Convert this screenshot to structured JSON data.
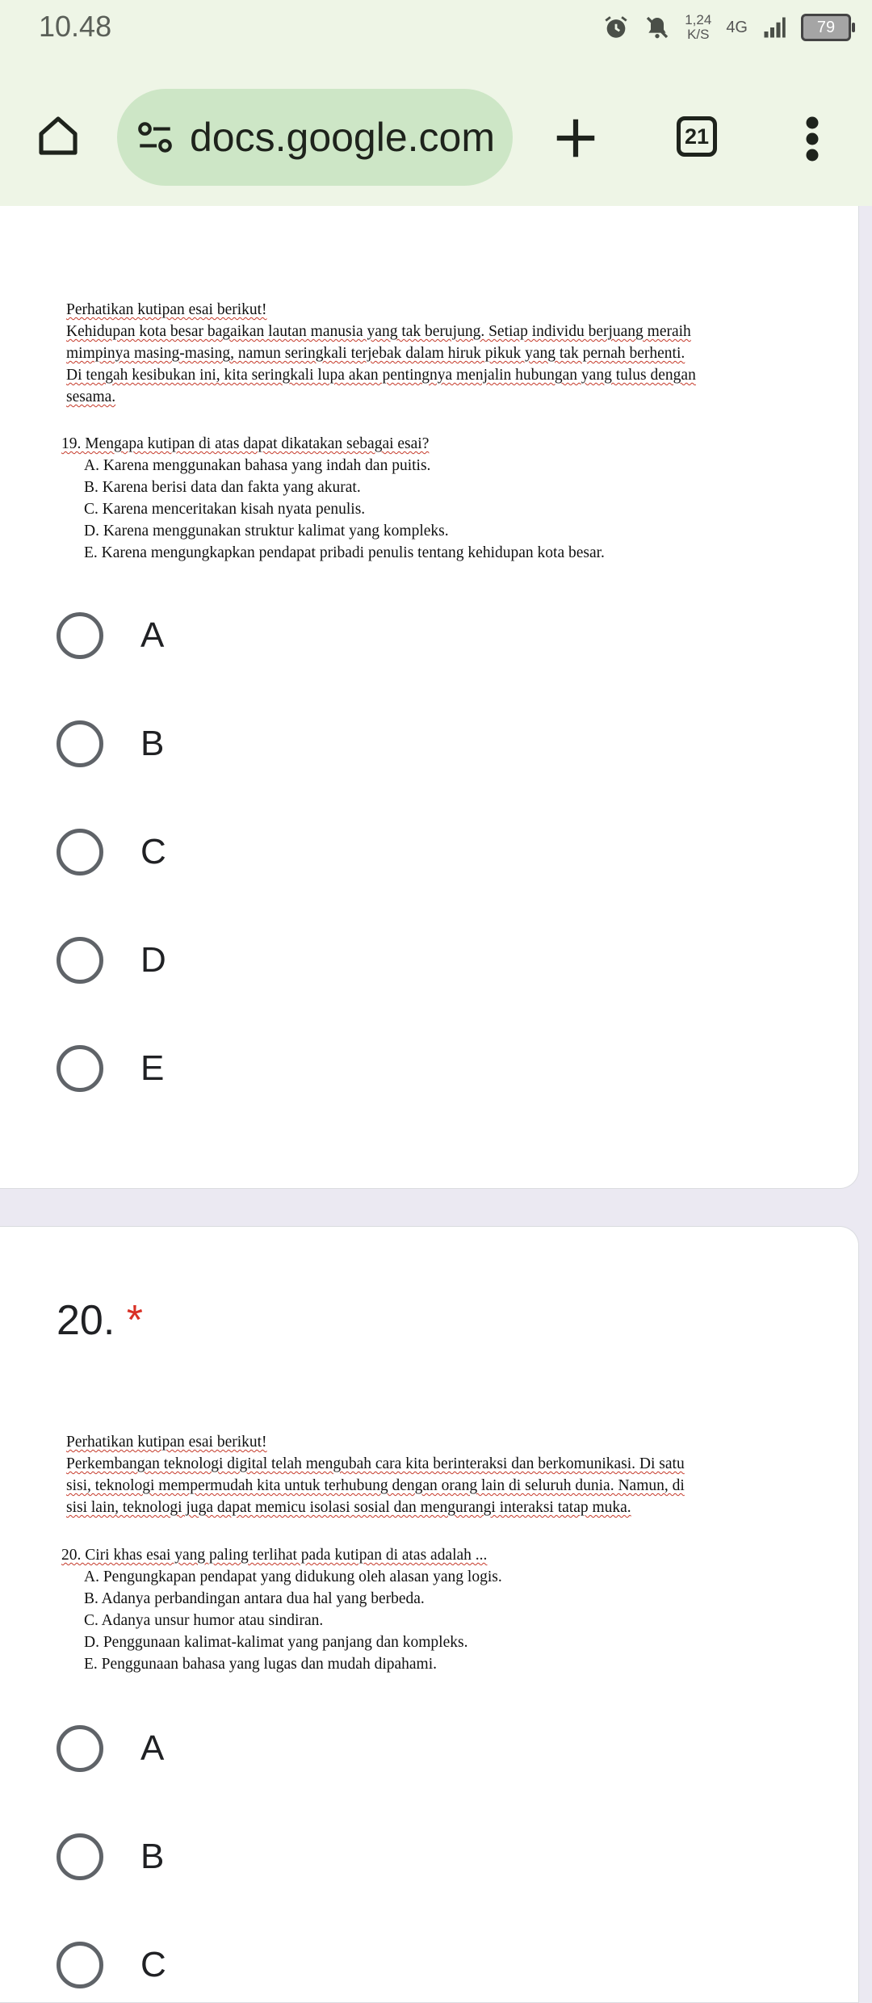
{
  "status_bar": {
    "time": "10.48",
    "speed_value": "1,24",
    "speed_unit": "K/S",
    "network": "4G",
    "battery": "79"
  },
  "browser": {
    "url": "docs.google.com",
    "tab_count": "21",
    "icons": [
      "home-icon",
      "site-info-icon",
      "new-tab-icon",
      "tab-switcher",
      "more-vert-icon"
    ]
  },
  "question19": {
    "passage_intro": "Perhatikan kutipan esai berikut!",
    "passage_l1": "Kehidupan kota besar bagaikan lautan manusia yang tak berujung. Setiap individu berjuang meraih",
    "passage_l2": "mimpinya masing-masing, namun seringkali terjebak dalam hiruk pikuk yang tak pernah berhenti.",
    "passage_l3": "Di tengah kesibukan ini, kita seringkali lupa akan pentingnya menjalin hubungan yang tulus dengan",
    "passage_l4": "sesama.",
    "question": "19. Mengapa kutipan di atas dapat dikatakan sebagai esai?",
    "opt_a": "A.  Karena menggunakan bahasa yang indah dan puitis.",
    "opt_b": "B.  Karena berisi data dan fakta yang akurat.",
    "opt_c": "C.  Karena menceritakan kisah nyata penulis.",
    "opt_d": "D.  Karena menggunakan struktur kalimat yang kompleks.",
    "opt_e": "E.  Karena mengungkapkan pendapat pribadi penulis tentang kehidupan kota besar.",
    "choices": [
      "A",
      "B",
      "C",
      "D",
      "E"
    ]
  },
  "question20": {
    "number": "20.",
    "required_mark": "*",
    "passage_intro": "Perhatikan kutipan esai berikut!",
    "passage_l1": "Perkembangan teknologi digital telah mengubah cara kita berinteraksi dan berkomunikasi. Di satu",
    "passage_l2": "sisi, teknologi mempermudah kita untuk terhubung dengan orang lain di seluruh dunia. Namun, di",
    "passage_l3": "sisi lain, teknologi juga dapat memicu isolasi sosial dan mengurangi interaksi tatap muka.",
    "question": "20. Ciri khas esai yang paling terlihat pada kutipan di atas adalah ...",
    "opt_a": "A.  Pengungkapan pendapat yang didukung oleh alasan yang logis.",
    "opt_b": "B.  Adanya perbandingan antara dua hal yang berbeda.",
    "opt_c": "C.  Adanya unsur humor atau sindiran.",
    "opt_d": "D.  Penggunaan kalimat-kalimat yang panjang dan kompleks.",
    "opt_e": "E.  Penggunaan bahasa yang lugas dan mudah dipahami.",
    "choices": [
      "A",
      "B",
      "C"
    ]
  }
}
